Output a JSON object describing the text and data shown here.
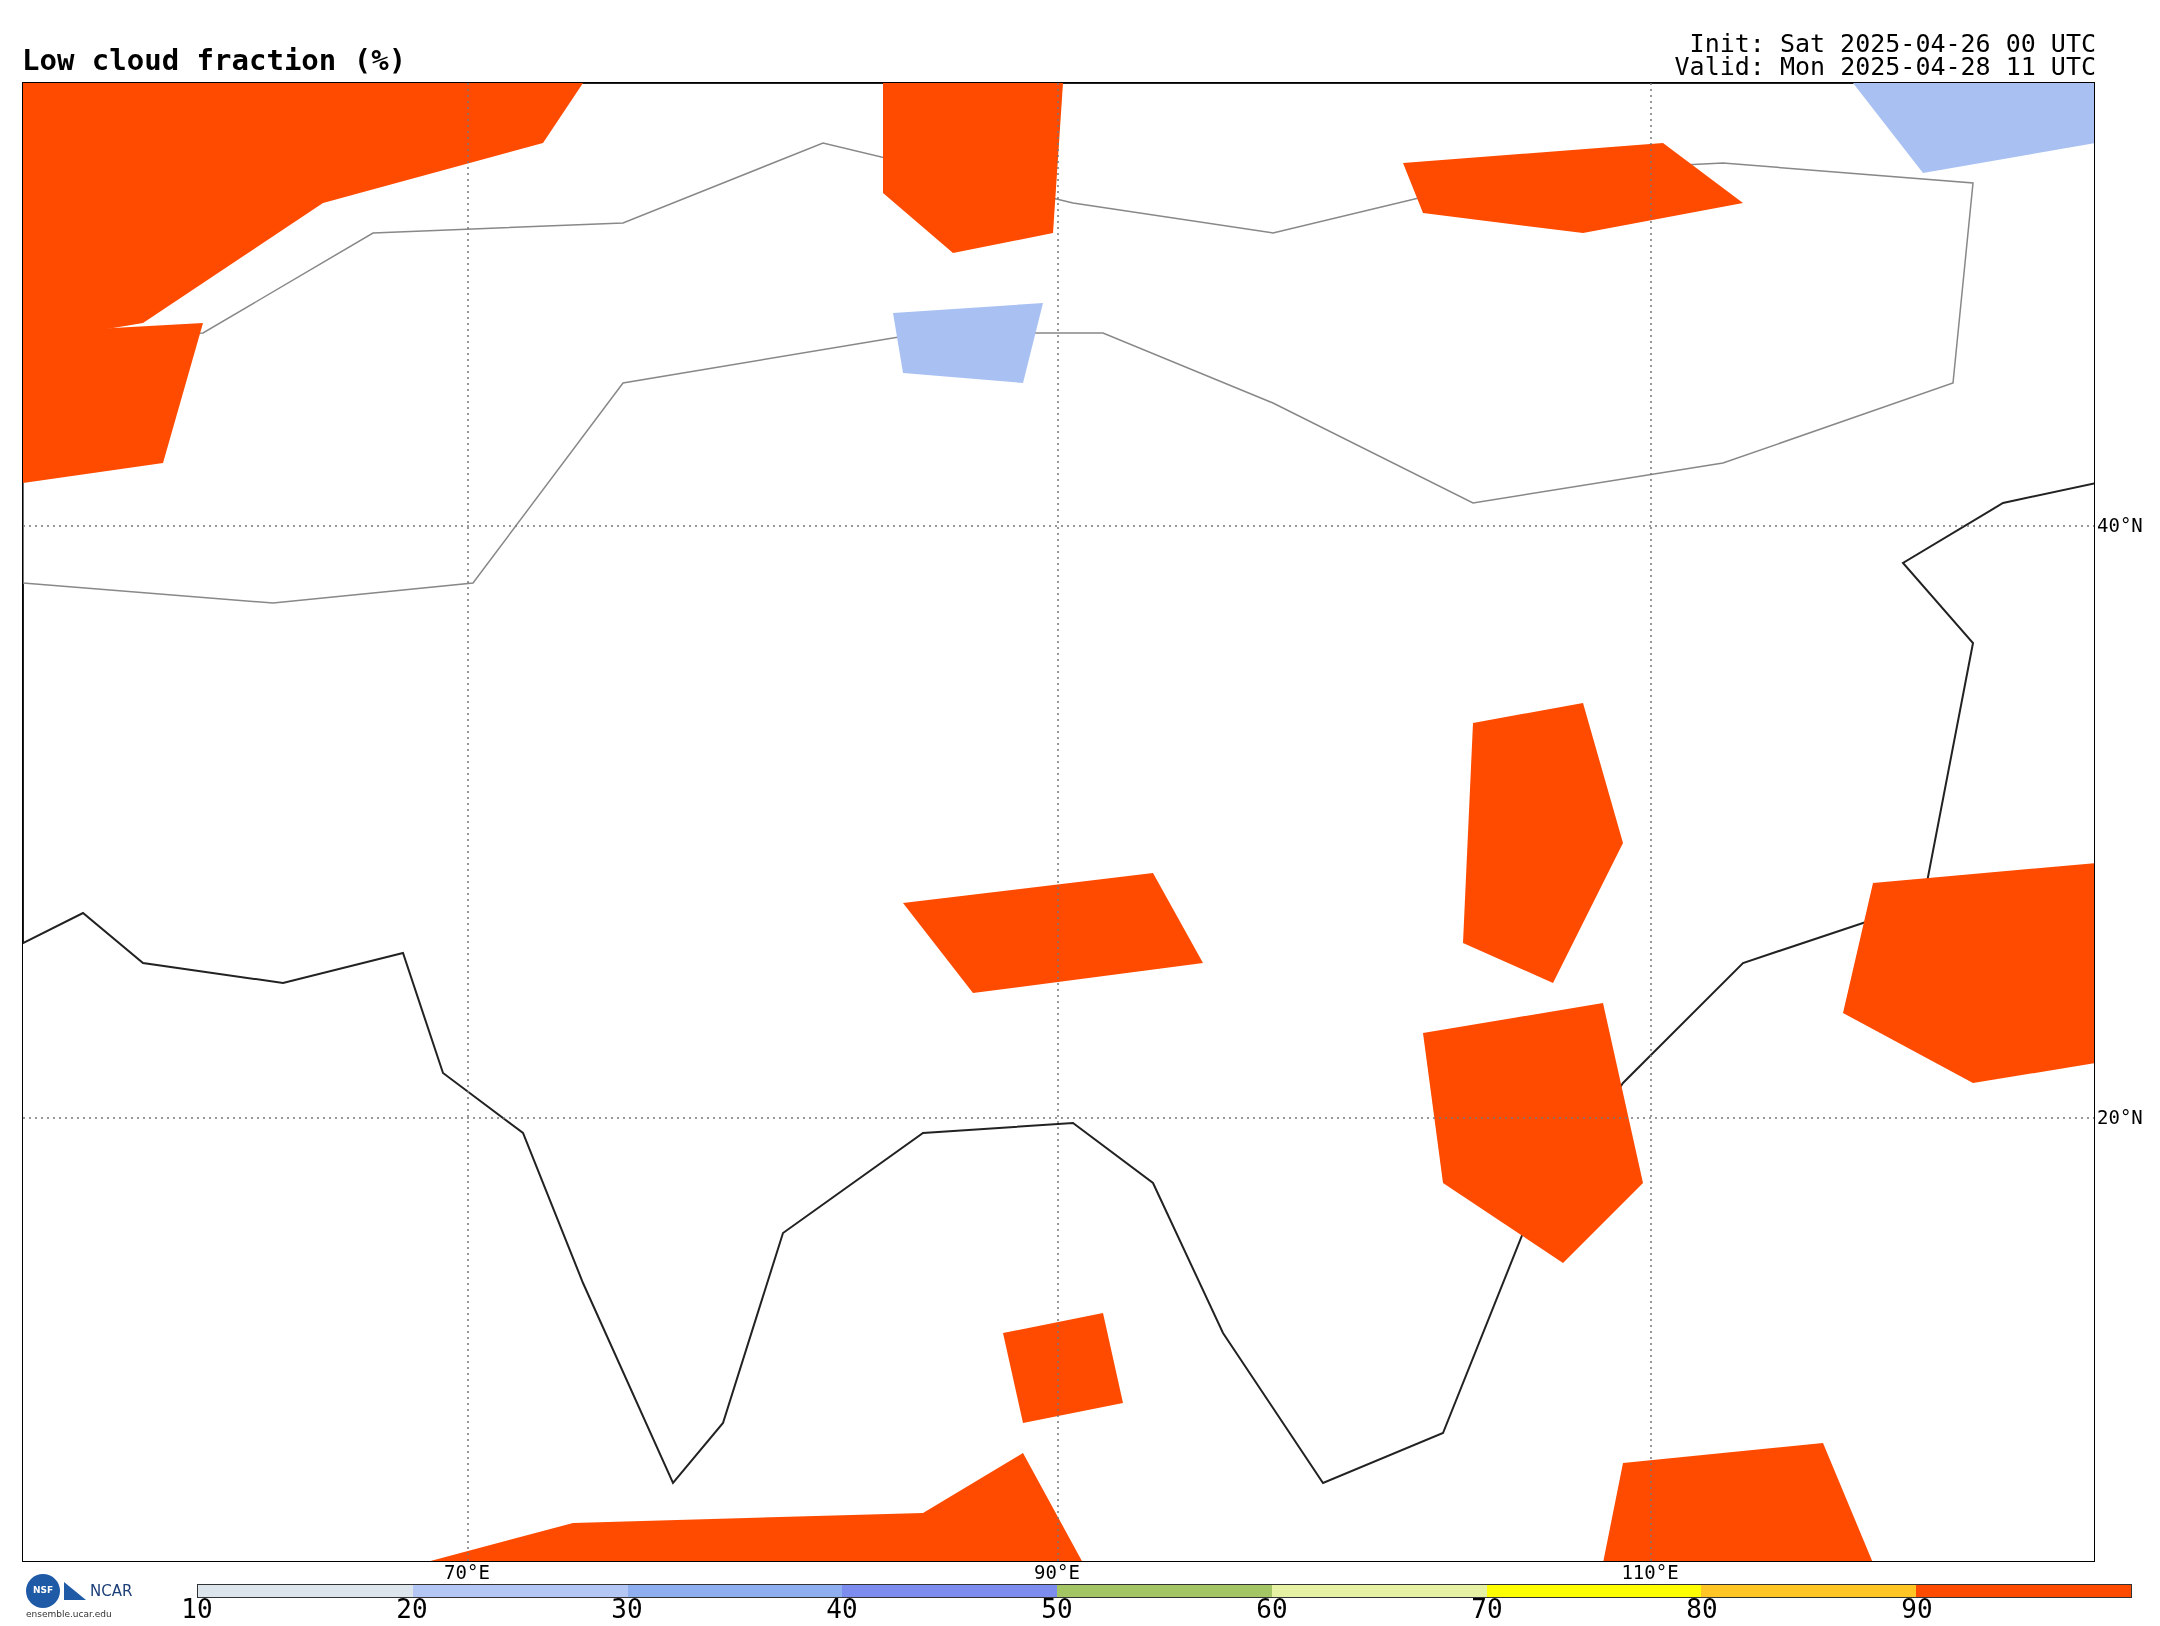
{
  "title": "Low cloud fraction (%)",
  "init": "Init: Sat 2025-04-26 00 UTC",
  "valid": "Valid: Mon 2025-04-28 11 UTC",
  "map": {
    "lat_labels": [
      "40°N",
      "20°N"
    ],
    "lon_labels": [
      "70°E",
      "90°E",
      "110°E"
    ]
  },
  "colorbar": {
    "ticks": [
      "10",
      "20",
      "30",
      "40",
      "50",
      "60",
      "70",
      "80",
      "90"
    ],
    "bins": [
      {
        "color": "#dde5ec"
      },
      {
        "color": "#b3c6f4"
      },
      {
        "color": "#8eaef0"
      },
      {
        "color": "#7c8cef"
      },
      {
        "color": "#a3c564"
      },
      {
        "color": "#e6f1a3"
      },
      {
        "color": "#ffff00"
      },
      {
        "color": "#ffc525"
      },
      {
        "color": "#ff4b00"
      }
    ]
  },
  "logo": {
    "seal": "NSF",
    "name": "NCAR",
    "url": "ensemble.ucar.edu"
  }
}
